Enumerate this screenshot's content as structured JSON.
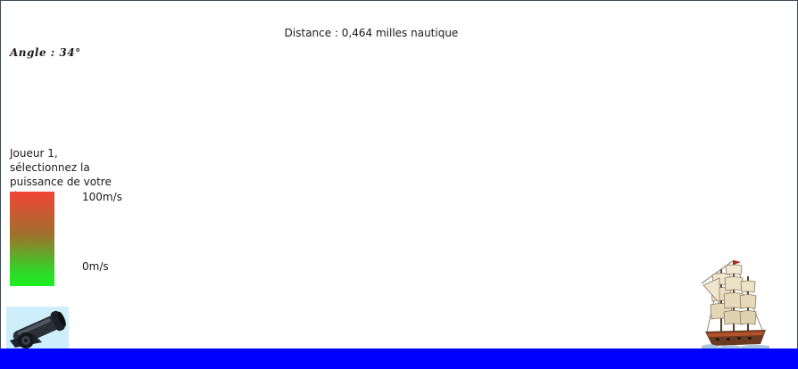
{
  "hud": {
    "distance_text": "Distance : 0,464 milles nautique",
    "angle_text": "Angle : 34°"
  },
  "power_selector": {
    "prompt": "Joueur 1, sélectionnez la puissance de votre tir.",
    "max_label": "100m/s",
    "min_label": "0m/s",
    "gradient_top_color": "#f24538",
    "gradient_bottom_color": "#1cf020"
  },
  "scene": {
    "sea_color": "#0000ff",
    "cannon_icon": "cannon-icon",
    "ship_icon": "sailing-ship-icon"
  }
}
